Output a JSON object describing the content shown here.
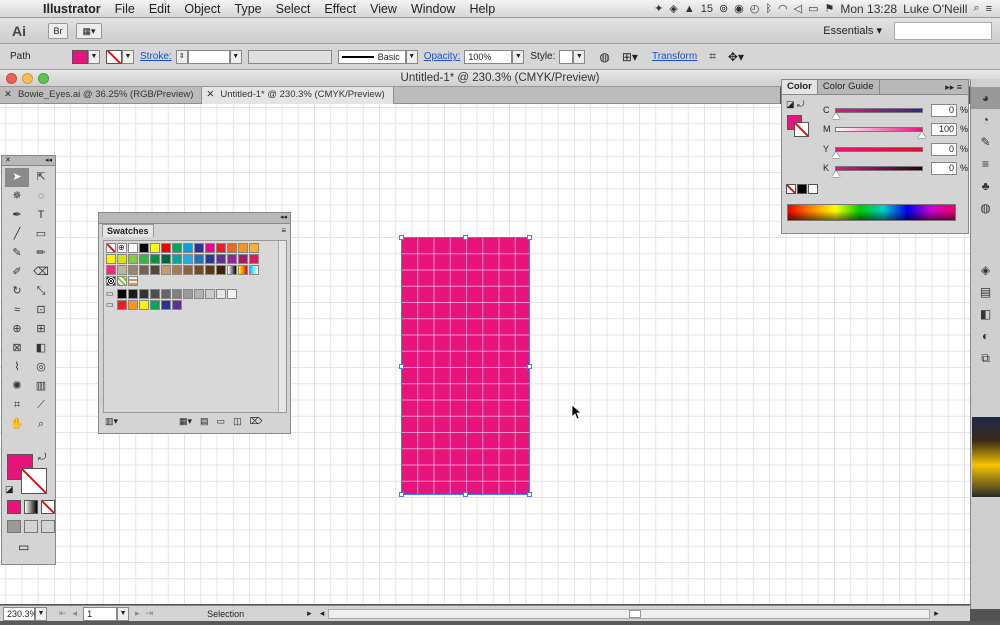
{
  "menubar": {
    "app": "Illustrator",
    "items": [
      "File",
      "Edit",
      "Object",
      "Type",
      "Select",
      "Effect",
      "View",
      "Window",
      "Help"
    ],
    "badge_number": "15",
    "clock": "Mon 13:28",
    "user": "Luke O'Neill"
  },
  "appbar": {
    "logo": "Ai",
    "workspace": "Essentials"
  },
  "controlbar": {
    "selection_type": "Path",
    "fill_color": "#e8137b",
    "stroke_label": "Stroke:",
    "brush_label": "Basic",
    "opacity_label": "Opacity:",
    "opacity_value": "100%",
    "style_label": "Style:",
    "transform_label": "Transform"
  },
  "window": {
    "title": "Untitled-1* @ 230.3% (CMYK/Preview)"
  },
  "tabs": [
    {
      "label": "Bowie_Eyes.ai @ 36.25% (RGB/Preview)",
      "active": false
    },
    {
      "label": "Untitled-1* @ 230.3% (CMYK/Preview)",
      "active": true
    }
  ],
  "swatches_panel": {
    "title": "Swatches"
  },
  "color_panel": {
    "tabs": [
      "Color",
      "Color Guide"
    ],
    "channels": [
      {
        "name": "C",
        "value": "0",
        "fraction": 0
      },
      {
        "name": "M",
        "value": "100",
        "fraction": 1
      },
      {
        "name": "Y",
        "value": "0",
        "fraction": 0
      },
      {
        "name": "K",
        "value": "0",
        "fraction": 0
      }
    ],
    "fill": "#e8137b"
  },
  "statusbar": {
    "zoom": "230.3%",
    "artboard": "1",
    "tool": "Selection"
  }
}
